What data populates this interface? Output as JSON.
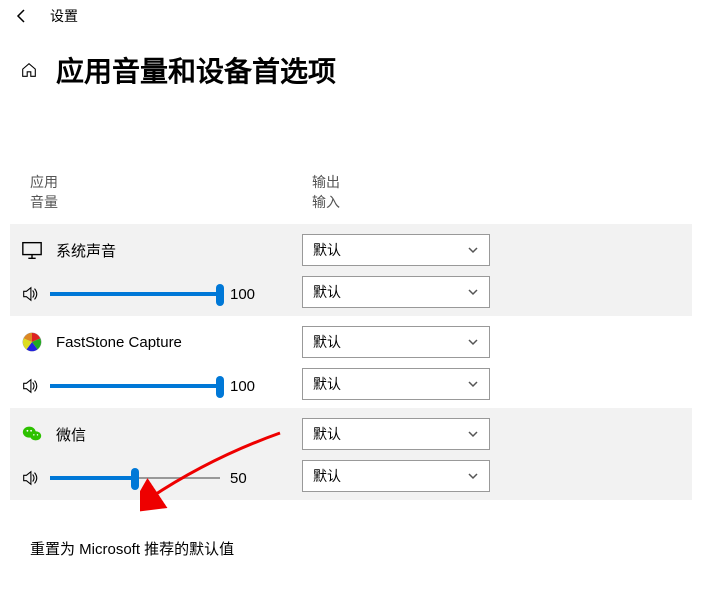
{
  "topbar": {
    "title": "设置"
  },
  "page_title": "应用音量和设备首选项",
  "columns": {
    "app": "应用",
    "volume": "音量",
    "output": "输出",
    "input": "输入"
  },
  "dropdown_default": "默认",
  "apps": [
    {
      "name": "系统声音",
      "volume": 100,
      "icon": "monitor"
    },
    {
      "name": "FastStone Capture",
      "volume": 100,
      "icon": "faststone"
    },
    {
      "name": "微信",
      "volume": 50,
      "icon": "wechat"
    }
  ],
  "footer_text": "重置为 Microsoft 推荐的默认值"
}
